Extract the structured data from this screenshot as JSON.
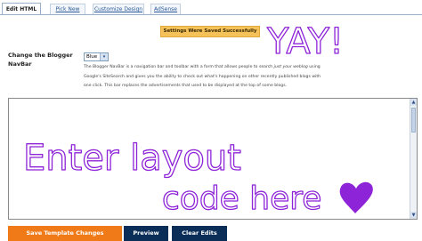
{
  "tabs": [
    {
      "label": "Edit HTML"
    },
    {
      "label": "Pick New"
    },
    {
      "label": "Customize Design"
    },
    {
      "label": "AdSense"
    }
  ],
  "status_banner": "Settings Were Saved Successfully",
  "navbar_setting": {
    "label": "Change the Blogger NavBar",
    "selected_color": "Blue",
    "description_part1": "The Blogger NavBar is a navigation bar and toolbar with a form that allows people to search ",
    "description_italic": "just your weblog",
    "description_part2": " using Google's SiteSearch and gives you the ability to check out what's happening on other recently published blogs with one click. This bar replaces the advertisements that used to be displayed at the top of some blogs."
  },
  "handwriting": {
    "yay": "YAY!",
    "line1": "Enter layout",
    "line2": "code here"
  },
  "buttons": {
    "save": "Save Template Changes",
    "preview": "Preview",
    "clear": "Clear Edits"
  },
  "colors": {
    "ink": "#8e24d8",
    "save_button": "#f07a18",
    "dark_button": "#0b2e59",
    "banner": "#f5c25a"
  }
}
